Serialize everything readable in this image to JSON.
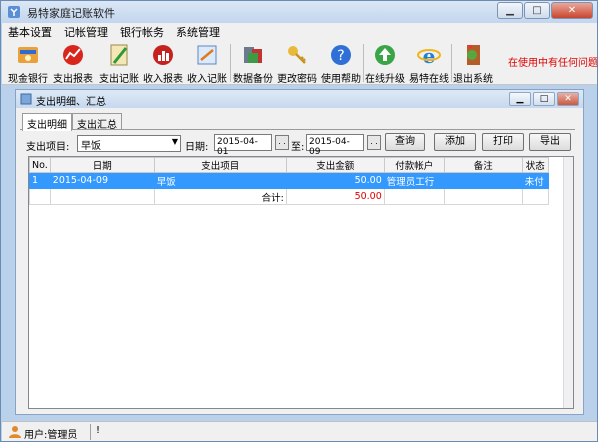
{
  "window": {
    "title": "易特家庭记账软件"
  },
  "menubar": [
    "基本设置",
    "记帐管理",
    "银行帐务",
    "系统管理"
  ],
  "toolbar": {
    "items": [
      {
        "label": "现金银行",
        "icon": "cash-bank-icon"
      },
      {
        "label": "支出报表",
        "icon": "expense-report-icon"
      },
      {
        "label": "支出记账",
        "icon": "expense-entry-icon"
      },
      {
        "label": "收入报表",
        "icon": "income-report-icon"
      },
      {
        "label": "收入记账",
        "icon": "income-entry-icon"
      },
      {
        "label": "数据备份",
        "icon": "data-backup-icon"
      },
      {
        "label": "更改密码",
        "icon": "change-password-icon"
      },
      {
        "label": "使用帮助",
        "icon": "help-icon"
      },
      {
        "label": "在线升级",
        "icon": "online-upgrade-icon"
      },
      {
        "label": "易特在线",
        "icon": "ie-browser-icon"
      },
      {
        "label": "退出系统",
        "icon": "exit-icon"
      }
    ],
    "notice": "在使用中有任何问题"
  },
  "child": {
    "title": "支出明细、汇总",
    "tabs": [
      "支出明细",
      "支出汇总"
    ],
    "filter": {
      "item_label": "支出项目:",
      "item_value": "早饭",
      "date_label": "日期:",
      "date_from": "2015-04-01",
      "to_label": "至:",
      "date_to": "2015-04-09",
      "dots": ". .",
      "query": "查询",
      "add": "添加",
      "print": "打印",
      "export": "导出"
    },
    "grid": {
      "columns": [
        "No.",
        "日期",
        "支出项目",
        "支出金额",
        "付款帐户",
        "备注",
        "状态"
      ],
      "rows": [
        {
          "no": "1",
          "date": "2015-04-09",
          "item": "早饭",
          "amount": "50.00",
          "account": "管理员工行",
          "note": "",
          "status": "未付"
        }
      ],
      "total_label": "合计:",
      "total_value": "50.00"
    }
  },
  "statusbar": {
    "user": "用户:管理员",
    "mark": "!"
  },
  "colors": {
    "accent": "#3399ff",
    "alert": "#e00000"
  }
}
